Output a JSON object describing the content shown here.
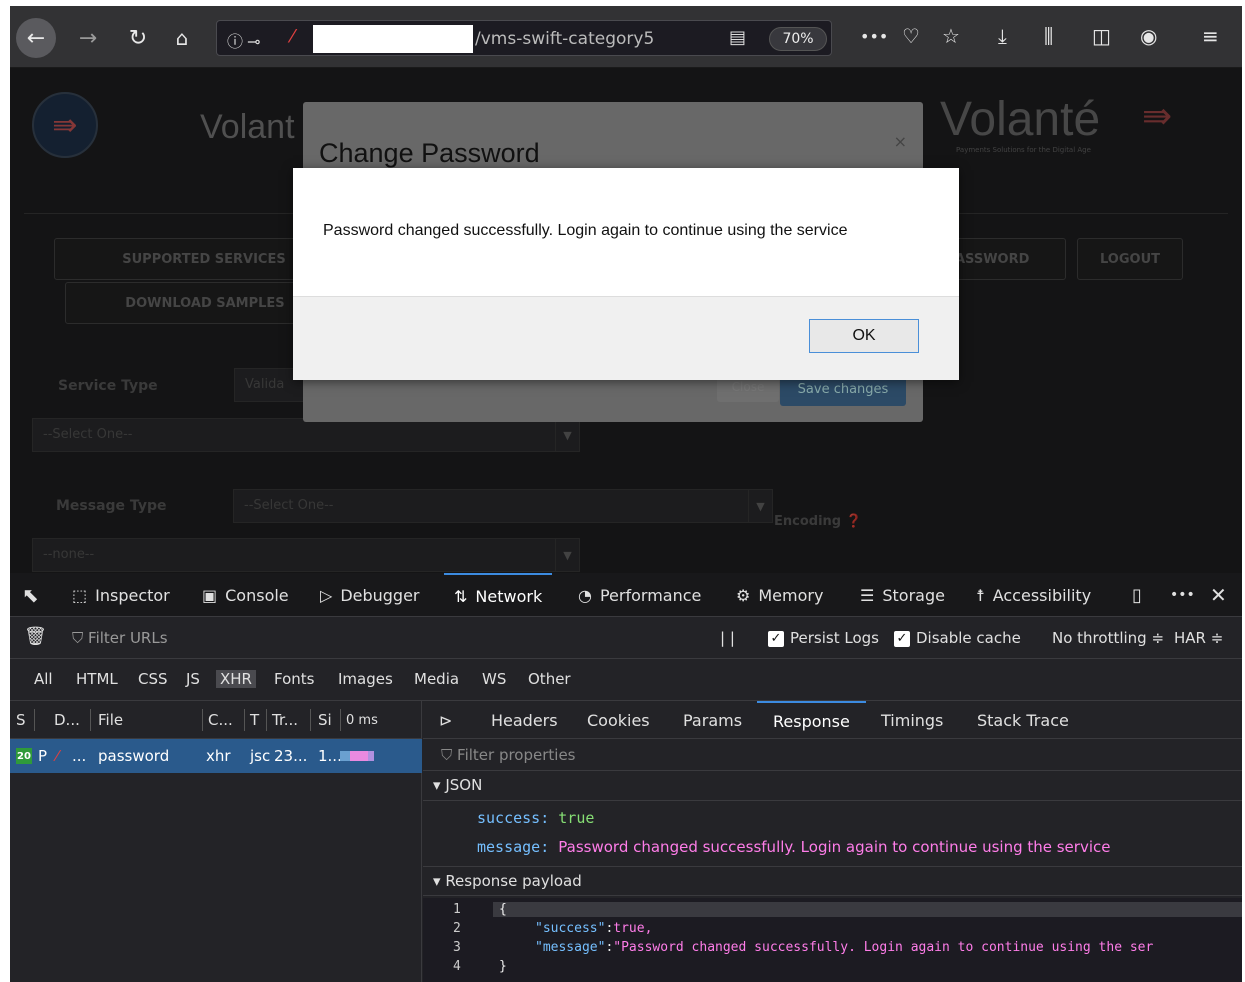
{
  "browser": {
    "url_text": "/vms-swift-category5",
    "zoom": "70%",
    "back_icon": "arrow-left",
    "forward_icon": "arrow-right",
    "reload_icon": "reload",
    "home_icon": "home",
    "page_actions_icon": "ellipsis",
    "pocket_icon": "pocket",
    "bookmark_icon": "star",
    "download_icon": "download",
    "library_icon": "library",
    "sidebar_icon": "sidebar",
    "account_icon": "account",
    "menu_icon": "hamburger"
  },
  "page": {
    "brand_left": "Volant",
    "brand_right": "Volanté",
    "tagline": "Payments Solutions for the Digital Age",
    "buttons": {
      "supported_services": "SUPPORTED SERVICES",
      "download_samples": "DOWNLOAD SAMPLES",
      "change_password_partial": "ASSWORD",
      "logout": "LOGOUT"
    },
    "service_type_label": "Service Type",
    "service_type_value": "Valida",
    "select_one": "--Select One--",
    "message_type_label": "Message Type",
    "message_type_value": "--Select One--",
    "encoding_label": "Encoding",
    "encoding_value": "--none--"
  },
  "bs_modal": {
    "title": "Change Password",
    "close_x": "×",
    "close_button": "Close",
    "save_button": "Save changes"
  },
  "alert": {
    "message": "Password changed successfully. Login again to continue using the service",
    "ok_button": "OK"
  },
  "devtools": {
    "tabs": [
      {
        "label": "Inspector",
        "icon": "inspector-icon"
      },
      {
        "label": "Console",
        "icon": "console-icon"
      },
      {
        "label": "Debugger",
        "icon": "debugger-icon"
      },
      {
        "label": "Network",
        "icon": "network-icon"
      },
      {
        "label": "Performance",
        "icon": "performance-icon"
      },
      {
        "label": "Memory",
        "icon": "memory-icon"
      },
      {
        "label": "Storage",
        "icon": "storage-icon"
      },
      {
        "label": "Accessibility",
        "icon": "accessibility-icon"
      }
    ],
    "filter_placeholder": "Filter URLs",
    "pause": "| |",
    "persist_logs": "Persist Logs",
    "disable_cache": "Disable cache",
    "throttling": "No throttling ≑",
    "har": "HAR ≑",
    "types": [
      "All",
      "HTML",
      "CSS",
      "JS",
      "XHR",
      "Fonts",
      "Images",
      "Media",
      "WS",
      "Other"
    ],
    "active_type": "XHR",
    "columns": {
      "status": "S",
      "domain": "D...",
      "file": "File",
      "cause": "C...",
      "type": "T",
      "transferred": "Tr...",
      "size": "Si",
      "waterfall": "0 ms"
    },
    "request": {
      "status": "20",
      "method": "P",
      "domain": "...",
      "file": "password",
      "cause": "xhr",
      "type": "jsc",
      "transferred": "23...",
      "size": "1..."
    },
    "detail_tabs": [
      "Headers",
      "Cookies",
      "Params",
      "Response",
      "Timings",
      "Stack Trace"
    ],
    "active_detail_tab": "Response",
    "filter_properties": "Filter properties",
    "json_section": "JSON",
    "json": {
      "success_key": "success:",
      "success_value": "true",
      "message_key": "message:",
      "message_value": "Password changed successfully. Login again to continue using the service"
    },
    "payload_section": "Response payload",
    "payload_lines": [
      {
        "n": "1",
        "text": "{"
      },
      {
        "n": "2",
        "key": "\"success\"",
        "sep": ":",
        "value": "true,"
      },
      {
        "n": "3",
        "key": "\"message\"",
        "sep": ":",
        "value": "\"Password changed successfully. Login again to continue using the ser"
      },
      {
        "n": "4",
        "text": "}"
      }
    ]
  },
  "colors": {
    "accent": "#3c8be0",
    "json_key": "#75bfff",
    "json_bool": "#86de74",
    "json_string": "#ff7de9",
    "selected_row": "#2a5a8c"
  }
}
